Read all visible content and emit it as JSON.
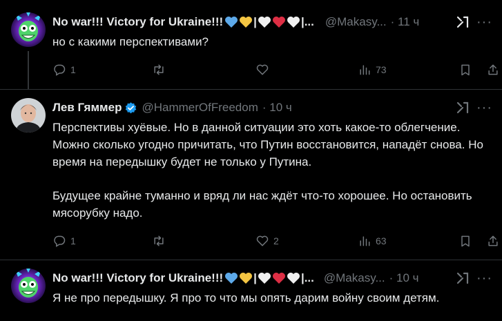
{
  "tweets": [
    {
      "name": "No war!!! Victory for Ukraine!!!",
      "name_emoji": [
        "blue-heart",
        "yellow-heart",
        "separator",
        "white-heart",
        "red-heart",
        "white-heart",
        "separator"
      ],
      "name_ellipsis": "...",
      "handle": "@Makasy...",
      "time": "· 11 ч",
      "text": [
        "но с какими перспективами?"
      ],
      "replies": "1",
      "retweets": "",
      "likes": "",
      "views": "73"
    },
    {
      "name": "Лев Гяммер",
      "verified": true,
      "handle": "@HammerOfFreedom",
      "time": "· 10 ч",
      "text": [
        "Перспективы хуёвые. Но в данной ситуации это хоть какое-то облегчение. Можно сколько угодно причитать, что Путин восстановится, нападёт снова. Но время на передышку будет не только у Путина.",
        "Будущее крайне туманно и вряд ли нас ждёт что-то хорошее. Но остановить мясорубку надо."
      ],
      "replies": "1",
      "retweets": "",
      "likes": "2",
      "views": "63"
    },
    {
      "name": "No war!!! Victory for Ukraine!!!",
      "name_emoji": [
        "blue-heart",
        "yellow-heart",
        "separator",
        "white-heart",
        "red-heart",
        "white-heart",
        "separator"
      ],
      "name_ellipsis": "...",
      "handle": "@Makasy...",
      "time": "· 10 ч",
      "text": [
        "Я не про передышку. Я про то что мы опять дарим войну своим детям."
      ]
    }
  ],
  "colors": {
    "background": "#000000",
    "text": "#e7e9ea",
    "muted": "#71767b",
    "divider": "#2f3336",
    "verified": "#1d9bf0",
    "blue_heart": "#5da9e9",
    "yellow_heart": "#f4c542",
    "red_heart": "#dd2e44",
    "white_heart": "#f0f0f0"
  }
}
